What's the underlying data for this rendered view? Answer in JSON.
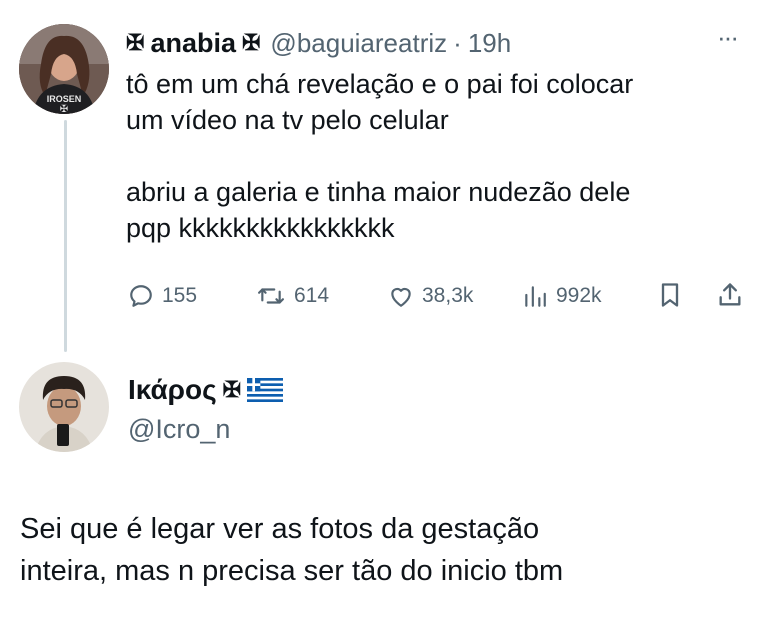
{
  "tweet": {
    "display_name": "anabia",
    "name_emoji": "✠",
    "handle": "@baguiareatriz",
    "separator": "·",
    "time": "19h",
    "text": "tô em um chá revelação e o pai foi colocar\num vídeo na tv pelo celular\n\nabriu a galeria e tinha maior nudezão dele\npqp kkkkkkkkkkkkkkkk",
    "actions": {
      "replies": "155",
      "retweets": "614",
      "likes": "38,3k",
      "views": "992k"
    },
    "more_label": "···",
    "avatar_text": "IROSEN"
  },
  "reply": {
    "display_name": "Ικάρος",
    "name_emoji": "✠",
    "flag_emoji": "🇬🇷",
    "handle": "@Icro_n",
    "text": "Sei que é legar ver as fotos da gestação\ninteira, mas n precisa ser tão do inicio tbm"
  },
  "colors": {
    "text": "#0f1419",
    "muted": "#536471",
    "thread_line": "#cfd9de"
  }
}
